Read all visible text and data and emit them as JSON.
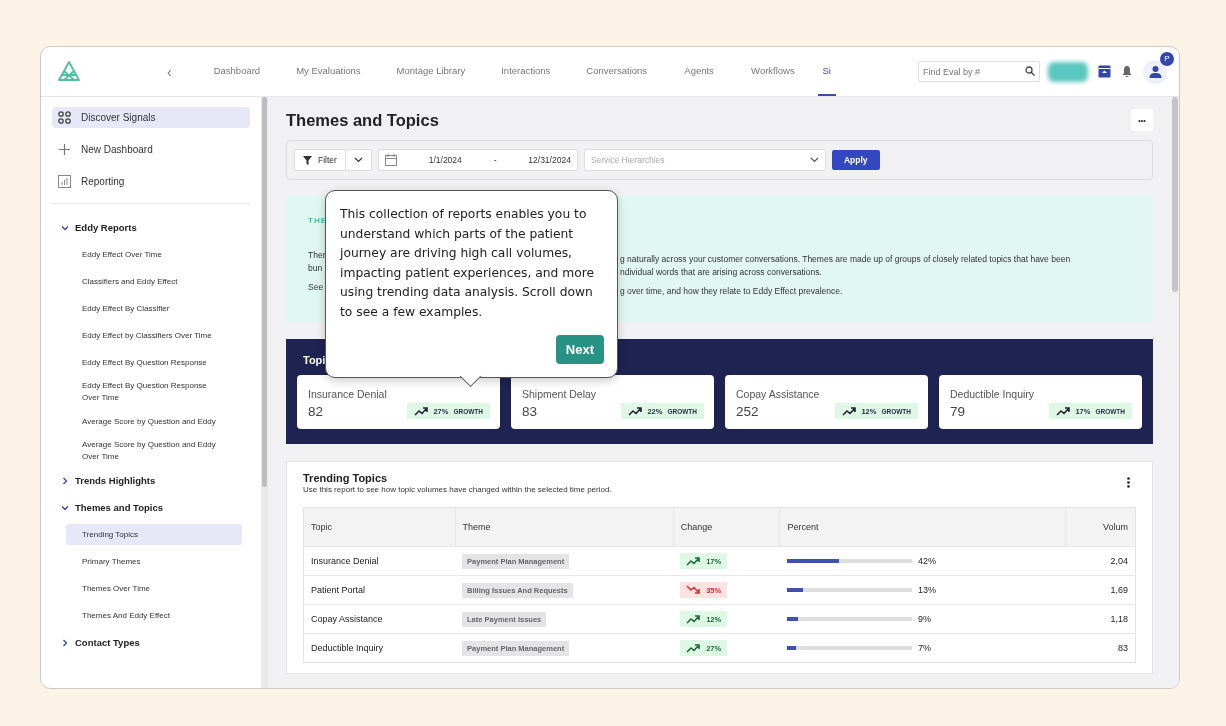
{
  "nav": {
    "back": "‹",
    "items": [
      {
        "label": "Dashboard",
        "selected": false
      },
      {
        "label": "My Evaluations",
        "selected": false
      },
      {
        "label": "Montage Library",
        "selected": false
      },
      {
        "label": "Interactions",
        "selected": false
      },
      {
        "label": "Conversations",
        "selected": false
      },
      {
        "label": "Agents",
        "selected": false
      },
      {
        "label": "Workflows",
        "selected": false
      },
      {
        "label": "Si",
        "selected": true
      }
    ],
    "search": {
      "placeholder": "Find Eval by #"
    },
    "avatar_badge": "P"
  },
  "sidebar": {
    "top": [
      {
        "kind": "grid",
        "label": "Discover Signals",
        "selected": true
      },
      {
        "kind": "plus",
        "label": "New Dashboard",
        "selected": false
      },
      {
        "kind": "chart",
        "label": "Reporting",
        "selected": false
      }
    ],
    "sections": [
      {
        "label": "Eddy Reports",
        "expanded": true,
        "children": [
          {
            "label": "Eddy Effect Over Time",
            "selected": false
          },
          {
            "label": "Classifiers and Eddy Effect",
            "selected": false
          },
          {
            "label": "Eddy Effect By Classifier",
            "selected": false
          },
          {
            "label": "Eddy Effect by Classifiers Over Time",
            "selected": false
          },
          {
            "label": "Eddy Effect By Question Response",
            "selected": false
          },
          {
            "label": "Eddy Effect By Question Response Over Time",
            "selected": false
          },
          {
            "label": "Average Score by Question and Eddy",
            "selected": false
          },
          {
            "label": "Average Score by Question and Eddy Over Time",
            "selected": false
          }
        ]
      },
      {
        "label": "Trends Highlights",
        "expanded": false
      },
      {
        "label": "Themes and Topics",
        "expanded": true,
        "children": [
          {
            "label": "Trending Topics",
            "selected": true
          },
          {
            "label": "Primary Themes",
            "selected": false
          },
          {
            "label": "Themes Over Time",
            "selected": false
          },
          {
            "label": "Themes And Eddy Effect",
            "selected": false
          }
        ]
      },
      {
        "label": "Contact Types",
        "expanded": false
      }
    ]
  },
  "page": {
    "title": "Themes and Topics",
    "more": "•••",
    "filters": {
      "filter": "Filter",
      "date_from": "1/1/2024",
      "date_sep": "-",
      "date_to": "12/31/2024",
      "hierarchy_placeholder": "Service Hierarchies",
      "apply": "Apply"
    },
    "info": {
      "title": "THE",
      "left": [
        "Ther",
        "bun",
        "See"
      ],
      "right": [
        "g naturally across your customer conversations. Themes are made up of groups of closely related topics that have been",
        "ndividual words that are arising across conversations.",
        "g over time, and how they relate to Eddy Effect prevalence."
      ]
    },
    "topics": {
      "title": "Topi",
      "cards": [
        {
          "name": "Insurance Denial",
          "count": "82",
          "growth": "27%",
          "growth_label": "GROWTH"
        },
        {
          "name": "Shipment Delay",
          "count": "83",
          "growth": "22%",
          "growth_label": "GROWTH"
        },
        {
          "name": "Copay Assistance",
          "count": "252",
          "growth": "12%",
          "growth_label": "GROWTH"
        },
        {
          "name": "Deductible Inquiry",
          "count": "79",
          "growth": "17%",
          "growth_label": "GROWTH"
        }
      ]
    },
    "trending": {
      "title": "Trending Topics",
      "subtitle": "Use this report to see how topic volumes have changed within the selected time period.",
      "columns": [
        "Topic",
        "Theme",
        "Change",
        "Percent",
        "Volum"
      ],
      "rows": [
        {
          "topic": "Insurance Denial",
          "theme": "Payment Plan Management",
          "change": "17%",
          "falling": false,
          "level": 0.42,
          "percent": "42%",
          "volume": "2,04"
        },
        {
          "topic": "Patient Portal",
          "theme": "Billing Issues And Requests",
          "change": "35%",
          "falling": true,
          "level": 0.13,
          "percent": "13%",
          "volume": "1,69"
        },
        {
          "topic": "Copay Assistance",
          "theme": "Late Payment Issues",
          "change": "12%",
          "falling": false,
          "level": 0.09,
          "percent": "9%",
          "volume": "1,18"
        },
        {
          "topic": "Deductible Inquiry",
          "theme": "Payment Plan Management",
          "change": "27%",
          "falling": false,
          "level": 0.07,
          "percent": "7%",
          "volume": "83"
        }
      ]
    }
  },
  "tooltip": {
    "text": "This collection of reports enables you to understand which parts of the patient journey are driving high call volumes, impacting patient experiences, and more using trending data analysis. Scroll down to see a few examples.",
    "button": "Next"
  }
}
